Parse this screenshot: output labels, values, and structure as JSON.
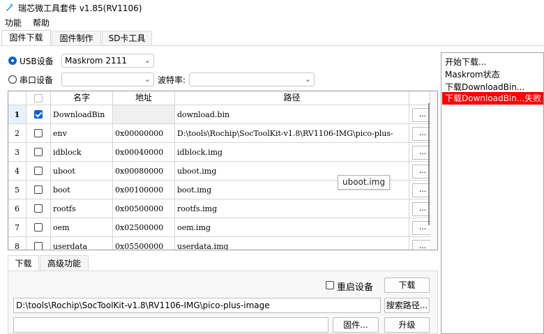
{
  "window": {
    "title": "瑞芯微工具套件 v1.85(RV1106)"
  },
  "menu": {
    "items": [
      "功能",
      "帮助"
    ]
  },
  "tabs": [
    "固件下载",
    "固件制作",
    "SD卡工具"
  ],
  "device": {
    "usb_label": "USB设备",
    "usb_selected": "Maskrom  2111",
    "serial_label": "串口设备",
    "serial_selected": "",
    "baud_label": "波特率:",
    "baud_selected": ""
  },
  "table": {
    "headers": {
      "name": "名字",
      "address": "地址",
      "path": "路径"
    },
    "rows": [
      {
        "num": "1",
        "checked": true,
        "name": "DownloadBin",
        "address": "",
        "path": "download.bin",
        "button": "..."
      },
      {
        "num": "2",
        "checked": false,
        "name": "env",
        "address": "0x00000000",
        "path": "D:\\tools\\Rochip\\SocToolKit-v1.8\\RV1106-IMG\\pico-plus-",
        "button": "..."
      },
      {
        "num": "3",
        "checked": false,
        "name": "idblock",
        "address": "0x00040000",
        "path": "idblock.img",
        "button": "..."
      },
      {
        "num": "4",
        "checked": false,
        "name": "uboot",
        "address": "0x00080000",
        "path": "uboot.img",
        "button": "..."
      },
      {
        "num": "5",
        "checked": false,
        "name": "boot",
        "address": "0x00100000",
        "path": "boot.img",
        "button": "..."
      },
      {
        "num": "6",
        "checked": false,
        "name": "rootfs",
        "address": "0x00500000",
        "path": "rootfs.img",
        "button": "..."
      },
      {
        "num": "7",
        "checked": false,
        "name": "oem",
        "address": "0x02500000",
        "path": "oem.img",
        "button": "..."
      },
      {
        "num": "8",
        "checked": false,
        "name": "userdata",
        "address": "0x05500000",
        "path": "userdata.img",
        "button": "..."
      }
    ]
  },
  "tooltip": "uboot.img",
  "log": {
    "lines": [
      "开始下载...",
      "Maskrom状态",
      "下载DownloadBin..."
    ],
    "error_line": "下载DownloadBin...失败"
  },
  "subtabs": [
    "下载",
    "高级功能"
  ],
  "download": {
    "reboot_label": "重启设备",
    "download_button": "下载",
    "path_value": "D:\\tools\\Rochip\\SocToolKit-v1.8\\RV1106-IMG\\pico-plus-image",
    "browse_button": "搜索路径...",
    "firmware_value": "",
    "firmware_button": "固件...",
    "upgrade_button": "升级"
  },
  "colors": {
    "accent": "#0a62c9",
    "error_bg": "#ff0000",
    "error_text": "#ffffff"
  }
}
